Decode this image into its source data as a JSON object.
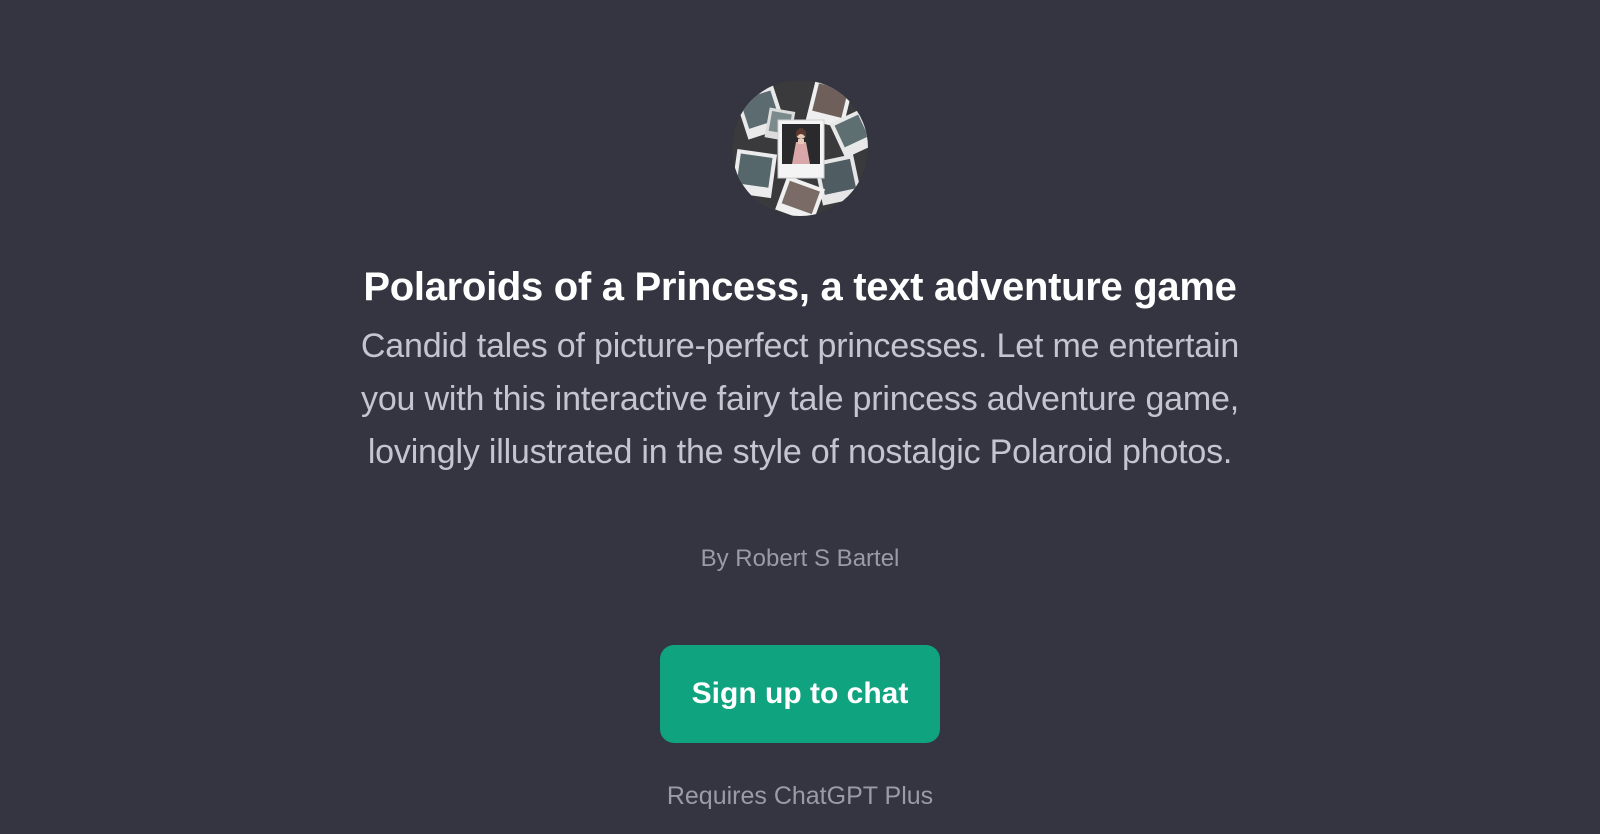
{
  "gpt": {
    "avatar_icon": "polaroid-collage-avatar",
    "title": "Polaroids of a Princess, a text adventure game",
    "description": "Candid tales of picture-perfect princesses. Let me entertain you with this interactive fairy tale princess adventure game, lovingly illustrated in the style of nostalgic Polaroid photos.",
    "author": "By Robert S Bartel"
  },
  "cta": {
    "label": "Sign up to chat"
  },
  "footer": {
    "requirement": "Requires ChatGPT Plus"
  },
  "colors": {
    "background": "#343541",
    "accent": "#10a37f",
    "title": "#ffffff",
    "body_text": "#c5c5d2",
    "muted_text": "#9b9ba6"
  }
}
